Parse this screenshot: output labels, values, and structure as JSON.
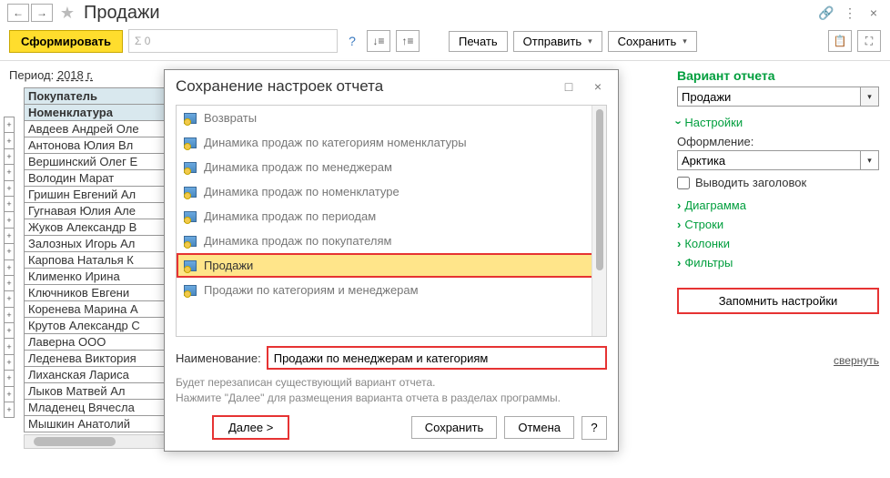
{
  "page": {
    "title": "Продажи"
  },
  "toolbar": {
    "primary": "Сформировать",
    "sigma_placeholder": "Σ 0",
    "print": "Печать",
    "send": "Отправить",
    "save": "Сохранить"
  },
  "period": {
    "label": "Период:",
    "value": "2018 г."
  },
  "headers": {
    "buyer": "Покупатель",
    "nomen": "Номенклатура"
  },
  "buyers": [
    "Авдеев Андрей Оле",
    "Антонова Юлия Вл",
    "Вершинский Олег Е",
    "Володин Марат",
    "Гришин Евгений Ал",
    "Гугнавая Юлия Але",
    "Жуков Александр В",
    "Залозных Игорь Ал",
    "Карпова Наталья К",
    "Клименко Ирина",
    "Ключников Евгени",
    "Коренева Марина А",
    "Крутов Александр С",
    "Лаверна ООО",
    "Леденева Виктория",
    "Лиханская Лариса",
    "Лыков Матвей Ал",
    "Младенец Вячесла",
    "Мышкин Анатолий"
  ],
  "rightPanel": {
    "title": "Вариант отчета",
    "variant_value": "Продажи",
    "settings": "Настройки",
    "design_label": "Оформление:",
    "design_value": "Арктика",
    "show_header": "Выводить заголовок",
    "sections": {
      "diagram": "Диаграмма",
      "rows": "Строки",
      "cols": "Колонки",
      "filters": "Фильтры"
    },
    "remember": "Запомнить настройки",
    "collapse": "свернуть"
  },
  "dialog": {
    "title": "Сохранение настроек отчета",
    "items": [
      "Возвраты",
      "Динамика продаж по категориям номенклатуры",
      "Динамика продаж по менеджерам",
      "Динамика продаж по номенклатуре",
      "Динамика продаж по периодам",
      "Динамика продаж по покупателям",
      "Продажи",
      "Продажи по категориям и менеджерам"
    ],
    "selected_index": 6,
    "name_label": "Наименование:",
    "name_value": "Продажи по менеджерам и категориям",
    "info": "Будет перезаписан существующий вариант отчета.\nНажмите \"Далее\" для размещения варианта отчета в разделах программы.",
    "next": "Далее  >",
    "save": "Сохранить",
    "cancel": "Отмена"
  }
}
